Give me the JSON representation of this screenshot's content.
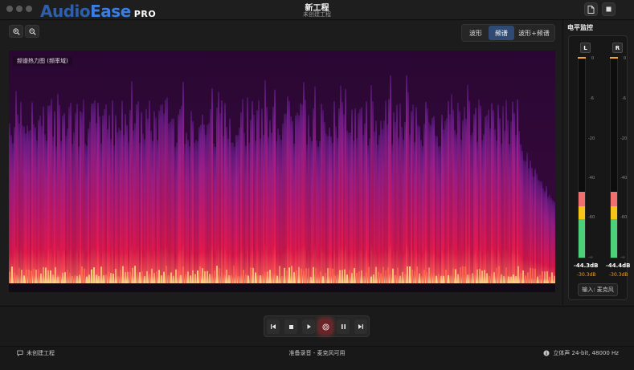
{
  "app": {
    "logo_part1": "Audio",
    "logo_part2": "Ease",
    "logo_edition": "PRO",
    "project_title": "新工程",
    "project_subtitle": "未创建工程"
  },
  "titlebar_buttons": [
    {
      "name": "new-file-icon"
    },
    {
      "name": "stop-square-icon"
    }
  ],
  "toolbar": {
    "zoom_in": "zoom-in-icon",
    "zoom_out": "zoom-out-icon",
    "view_modes": [
      "波形",
      "频谱",
      "波形+频谱"
    ],
    "active_mode": "频谱"
  },
  "spectrogram": {
    "label": "频谱热力图 (频率域)"
  },
  "meter": {
    "title": "电平监控",
    "left_label": "L",
    "right_label": "R",
    "ticks": [
      "0",
      "-6",
      "-20",
      "-40",
      "-60",
      "-∞"
    ],
    "left_value": "-44.3dB",
    "left_peak": "-30.3dB",
    "right_value": "-44.4dB",
    "right_peak": "-30.3dB",
    "input_label": "输入: 麦克风",
    "colors": {
      "green": "#4cd07a",
      "yellow": "#f5c518",
      "red": "#f07070",
      "peak": "#f5a623"
    }
  },
  "transport": {
    "buttons": [
      "skip-back-icon",
      "stop-icon",
      "play-icon",
      "record-icon",
      "pause-icon",
      "skip-forward-icon"
    ]
  },
  "status": {
    "left": "未创建工程",
    "middle": "准备录音 - 麦克风可用",
    "right": "立体声 24-bit, 48000 Hz"
  }
}
